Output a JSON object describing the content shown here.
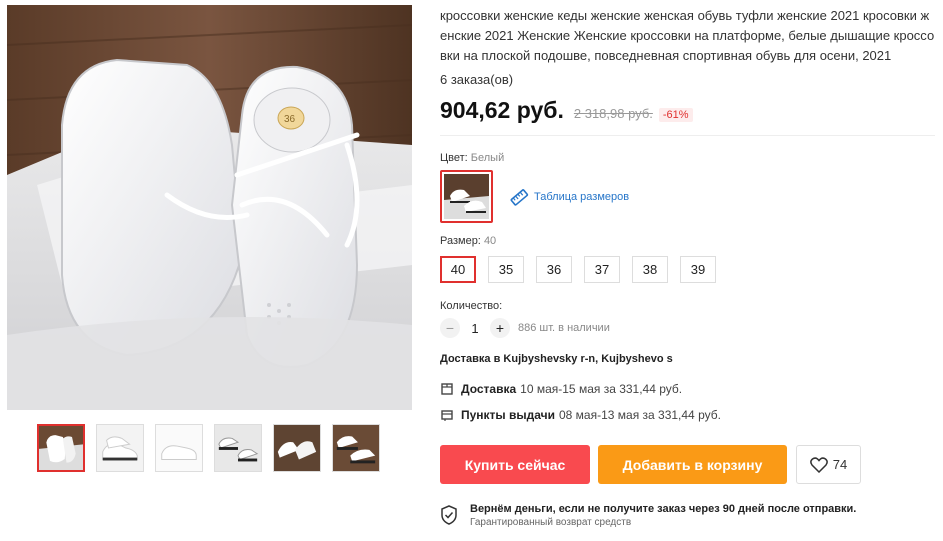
{
  "product": {
    "title": "кроссовки женские кеды женские женская обувь туфли женские 2021 кросовки женские 2021 Женские Женские кроссовки на платформе, белые дышащие кроссовки на плоской подошве, повседневная спортивная обувь для осени, 2021",
    "orders": "6 заказа(ов)",
    "price": "904,62 руб.",
    "old_price": "2 318,98 руб.",
    "discount": "-61%",
    "main_image_icon": "sneakers-photo"
  },
  "thumbnails": [
    {
      "name": "thumb-1",
      "active": true
    },
    {
      "name": "thumb-2",
      "active": false
    },
    {
      "name": "thumb-3",
      "active": false
    },
    {
      "name": "thumb-4",
      "active": false
    },
    {
      "name": "thumb-5",
      "active": false
    },
    {
      "name": "thumb-6",
      "active": false
    }
  ],
  "color": {
    "label": "Цвет:",
    "value": "Белый",
    "size_table": "Таблица размеров"
  },
  "size": {
    "label": "Размер:",
    "value": "40",
    "options": [
      "40",
      "35",
      "36",
      "37",
      "38",
      "39"
    ],
    "selected": "40"
  },
  "quantity": {
    "label": "Количество:",
    "minus": "−",
    "value": "1",
    "plus": "+",
    "stock": "886 шт. в наличии"
  },
  "delivery": {
    "to": "Доставка в Kujbyshevsky r-n, Kujbyshevo s",
    "ship_label": "Доставка",
    "ship_text": "10 мая-15 мая за 331,44 руб.",
    "pickup_label": "Пункты выдачи",
    "pickup_text": "08 мая-13 мая за 331,44 руб."
  },
  "actions": {
    "buy": "Купить сейчас",
    "cart": "Добавить в корзину",
    "wishlist_count": "74"
  },
  "guarantee": {
    "title": "Вернём деньги, если не получите заказ через 90 дней после отправки.",
    "subtitle": "Гарантированный возврат средств"
  },
  "colors": {
    "accent_red": "#e0302e",
    "buy_button": "#f94a4f",
    "cart_button": "#fa9a16",
    "link": "#2776c9"
  }
}
